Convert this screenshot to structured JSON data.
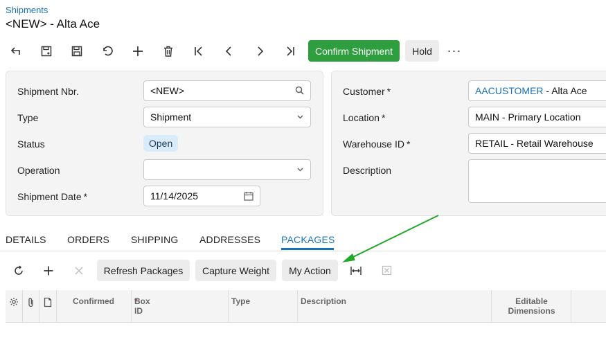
{
  "header": {
    "breadcrumb": "Shipments",
    "title": "<NEW> - Alta Ace"
  },
  "toolbar": {
    "confirm_label": "Confirm Shipment",
    "hold_label": "Hold",
    "more_label": "···",
    "confirm_color": "#2e9e3e"
  },
  "left_panel": {
    "shipment_nbr_label": "Shipment Nbr.",
    "shipment_nbr_value": "<NEW>",
    "type_label": "Type",
    "type_value": "Shipment",
    "status_label": "Status",
    "status_value": "Open",
    "operation_label": "Operation",
    "operation_value": "",
    "shipment_date_label": "Shipment Date",
    "shipment_date_value": "11/14/2025"
  },
  "right_panel": {
    "customer_label": "Customer",
    "customer_code": "AACUSTOMER",
    "customer_name": " - Alta Ace",
    "location_label": "Location",
    "location_value": "MAIN - Primary Location",
    "warehouse_label": "Warehouse ID",
    "warehouse_value": "RETAIL - Retail Warehouse",
    "description_label": "Description",
    "description_value": ""
  },
  "required_marker": "*",
  "tabs": [
    {
      "label": "DETAILS"
    },
    {
      "label": "ORDERS"
    },
    {
      "label": "SHIPPING"
    },
    {
      "label": "ADDRESSES"
    },
    {
      "label": "PACKAGES"
    }
  ],
  "active_tab": "PACKAGES",
  "grid_toolbar": {
    "refresh_label": "Refresh Packages",
    "capture_label": "Capture Weight",
    "my_action_label": "My Action"
  },
  "grid": {
    "columns": [
      "Confirmed",
      "Box ID",
      "Type",
      "Description",
      "Editable",
      "Dimensions"
    ]
  },
  "accent_color": "#1a73b8",
  "annotation_arrow_color": "#22a82a"
}
